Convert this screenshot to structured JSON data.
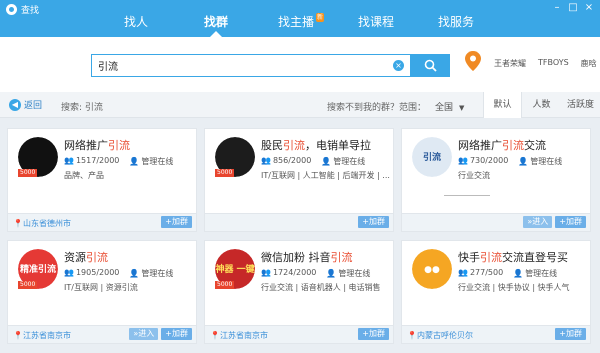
{
  "window": {
    "title": "查找",
    "buttons": [
      "–",
      "□",
      "×"
    ]
  },
  "tabs": [
    {
      "label": "找人"
    },
    {
      "label": "找群"
    },
    {
      "label": "找主播",
      "badge": "新"
    },
    {
      "label": "找课程"
    },
    {
      "label": "找服务"
    }
  ],
  "search": {
    "value": "引流",
    "clear": "×"
  },
  "hot_links": [
    "王者荣耀",
    "TFBOYS",
    "鹿晗"
  ],
  "filter": {
    "back_label": "返回",
    "summary_label": "搜索: 引流",
    "not_found": "搜索不到我的群？",
    "range_label": "范围：",
    "range_value": "全国",
    "sort_tabs": [
      "默认",
      "人数",
      "活跃度"
    ]
  },
  "cards": [
    {
      "name_a": "网络推广",
      "name_hl": "引流",
      "name_b": "",
      "members": "1517/2000",
      "admin": "管理在线",
      "tags": "品牌、产品",
      "tag": "5000",
      "location": "山东省德州市",
      "enter": "",
      "join": "+加群",
      "avatar": "#111111",
      "avatar_text": "",
      "avatar_text_color": "#ffffff"
    },
    {
      "name_a": "股民",
      "name_hl": "引流",
      "name_b": "，电销单导拉",
      "members": "856/2000",
      "admin": "管理在线",
      "tags": "IT/互联网 | 人工智能 | 后端开发 | ...",
      "tag": "5000",
      "location": "",
      "enter": "",
      "join": "+加群",
      "avatar": "#1c1c1c",
      "avatar_text": "",
      "avatar_text_color": "#ffffff"
    },
    {
      "name_a": "网络推广",
      "name_hl": "引流",
      "name_b": "交流",
      "members": "730/2000",
      "admin": "管理在线",
      "tags": "行业交流",
      "tag": "",
      "location": "",
      "enter": "»进入",
      "join": "+加群",
      "avatar": "#dfe9f3",
      "avatar_text": "引流",
      "avatar_text_color": "#2a5a9a"
    },
    {
      "name_a": "资源",
      "name_hl": "引流",
      "name_b": "",
      "members": "1905/2000",
      "admin": "管理在线",
      "tags": "IT/互联网 | 资源引流",
      "tag": "5000",
      "location": "江苏省南京市",
      "enter": "»进入",
      "join": "+加群",
      "avatar": "#e53935",
      "avatar_text": "精准引流",
      "avatar_text_color": "#ffffff"
    },
    {
      "name_a": "微信加粉 抖音",
      "name_hl": "引流",
      "name_b": "",
      "members": "1724/2000",
      "admin": "管理在线",
      "tags": "行业交流 | 语音机器人 | 电话销售",
      "tag": "5000",
      "location": "江苏省南京市",
      "enter": "",
      "join": "+加群",
      "avatar": "#c62828",
      "avatar_text": "微商神器 一键转发",
      "avatar_text_color": "#ffe15a"
    },
    {
      "name_a": "快手",
      "name_hl": "引流",
      "name_b": "交流直登号买",
      "members": "277/500",
      "admin": "管理在线",
      "tags": "行业交流 | 快手协议 | 快手人气",
      "tag": "",
      "location": "内蒙古呼伦贝尔",
      "enter": "",
      "join": "+加群",
      "avatar": "#f5a623",
      "avatar_text": "●●",
      "avatar_text_color": "#ffffff"
    }
  ]
}
